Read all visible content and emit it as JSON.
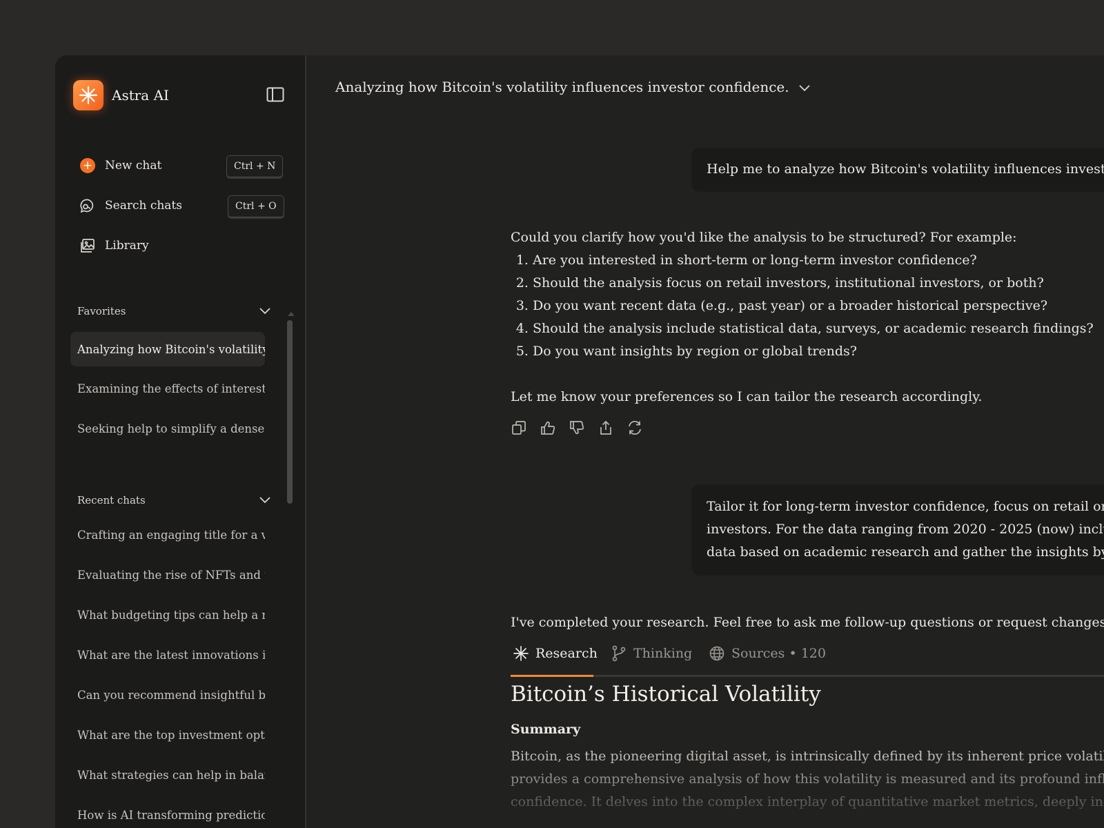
{
  "app": {
    "name": "Astra AI",
    "accent": "#f47124"
  },
  "sidebar": {
    "nav": [
      {
        "label": "New chat",
        "shortcut": "Ctrl + N",
        "icon": "plus-circle-icon"
      },
      {
        "label": "Search chats",
        "shortcut": "Ctrl + O",
        "icon": "chat-search-icon"
      },
      {
        "label": "Library",
        "icon": "image-library-icon"
      }
    ],
    "favorites": {
      "title": "Favorites",
      "items": [
        "Analyzing how Bitcoin's volatility...",
        "Examining the effects of interest r...",
        "Seeking help to simplify a dense a..."
      ]
    },
    "recent": {
      "title": "Recent chats",
      "items": [
        "Crafting an engaging title for a vis...",
        "Evaluating the rise of NFTs and th...",
        "What budgeting tips can help a ne...",
        "What are the latest innovations in...",
        "Can you recommend insightful bo...",
        "What are the top investment optio...",
        "What strategies can help in balan...",
        "How is AI transforming predictio..."
      ]
    }
  },
  "header": {
    "title": "Analyzing how Bitcoin's volatility influences investor confidence."
  },
  "messages": {
    "user1": "Help me to analyze how Bitcoin's volatility influences investor confidence.",
    "assistant1": {
      "intro": "Could you clarify how you'd like the analysis to be structured? For example:",
      "list": [
        "Are you interested in short-term or long-term investor confidence?",
        "Should the analysis focus on retail investors, institutional investors, or both?",
        "Do you want recent data (e.g., past year) or a broader historical perspective?",
        "Should the analysis include statistical data, surveys, or academic research findings?",
        "Do you want insights by region or global trends?"
      ],
      "outro": "Let me know your preferences so I can tailor the research accordingly."
    },
    "user2": [
      "Tailor it for long-term investor confidence, focus on retail or individual",
      "investors. For the data ranging from 2020 - 2025 (now) including statistical",
      "data based on academic research and gather the insights by global trends."
    ],
    "assistant2": "I've completed your research. Feel free to ask me follow-up questions or request changes."
  },
  "tabs": [
    {
      "label": "Research",
      "icon": "sparkle-icon",
      "active": true
    },
    {
      "label": "Thinking",
      "icon": "branch-icon",
      "active": false
    },
    {
      "label": "Sources • 120",
      "icon": "globe-icon",
      "active": false
    }
  ],
  "report": {
    "title": "Bitcoin’s Historical Volatility",
    "summary_label": "Summary",
    "summary_lines": [
      "Bitcoin, as the pioneering digital asset, is intrinsically defined by its inherent price volatility. This report",
      "provides a comprehensive analysis of how this volatility is measured and its profound influence on investor",
      "confidence. It delves into the complex interplay of quantitative market metrics, deeply ingrained"
    ]
  }
}
